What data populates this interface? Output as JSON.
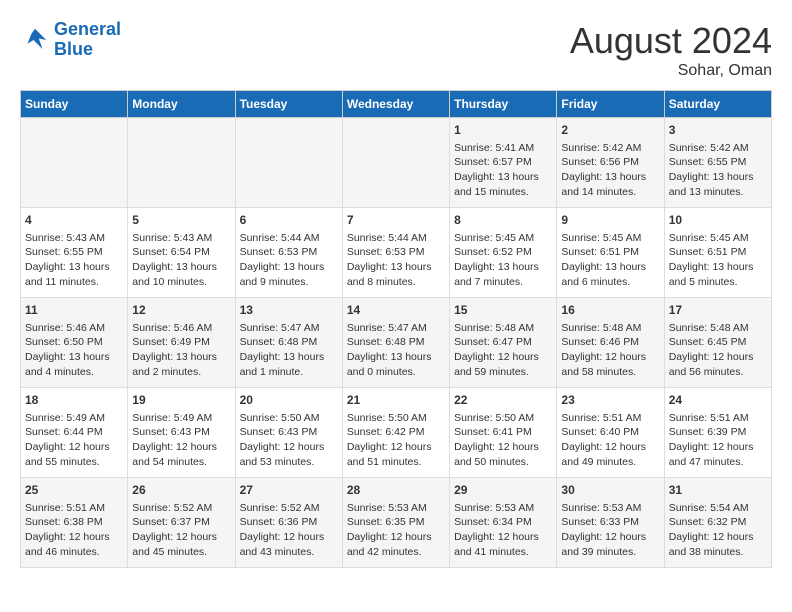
{
  "header": {
    "logo_line1": "General",
    "logo_line2": "Blue",
    "main_title": "August 2024",
    "subtitle": "Sohar, Oman"
  },
  "days_of_week": [
    "Sunday",
    "Monday",
    "Tuesday",
    "Wednesday",
    "Thursday",
    "Friday",
    "Saturday"
  ],
  "weeks": [
    [
      {
        "day": "",
        "content": ""
      },
      {
        "day": "",
        "content": ""
      },
      {
        "day": "",
        "content": ""
      },
      {
        "day": "",
        "content": ""
      },
      {
        "day": "1",
        "content": "Sunrise: 5:41 AM\nSunset: 6:57 PM\nDaylight: 13 hours\nand 15 minutes."
      },
      {
        "day": "2",
        "content": "Sunrise: 5:42 AM\nSunset: 6:56 PM\nDaylight: 13 hours\nand 14 minutes."
      },
      {
        "day": "3",
        "content": "Sunrise: 5:42 AM\nSunset: 6:55 PM\nDaylight: 13 hours\nand 13 minutes."
      }
    ],
    [
      {
        "day": "4",
        "content": "Sunrise: 5:43 AM\nSunset: 6:55 PM\nDaylight: 13 hours\nand 11 minutes."
      },
      {
        "day": "5",
        "content": "Sunrise: 5:43 AM\nSunset: 6:54 PM\nDaylight: 13 hours\nand 10 minutes."
      },
      {
        "day": "6",
        "content": "Sunrise: 5:44 AM\nSunset: 6:53 PM\nDaylight: 13 hours\nand 9 minutes."
      },
      {
        "day": "7",
        "content": "Sunrise: 5:44 AM\nSunset: 6:53 PM\nDaylight: 13 hours\nand 8 minutes."
      },
      {
        "day": "8",
        "content": "Sunrise: 5:45 AM\nSunset: 6:52 PM\nDaylight: 13 hours\nand 7 minutes."
      },
      {
        "day": "9",
        "content": "Sunrise: 5:45 AM\nSunset: 6:51 PM\nDaylight: 13 hours\nand 6 minutes."
      },
      {
        "day": "10",
        "content": "Sunrise: 5:45 AM\nSunset: 6:51 PM\nDaylight: 13 hours\nand 5 minutes."
      }
    ],
    [
      {
        "day": "11",
        "content": "Sunrise: 5:46 AM\nSunset: 6:50 PM\nDaylight: 13 hours\nand 4 minutes."
      },
      {
        "day": "12",
        "content": "Sunrise: 5:46 AM\nSunset: 6:49 PM\nDaylight: 13 hours\nand 2 minutes."
      },
      {
        "day": "13",
        "content": "Sunrise: 5:47 AM\nSunset: 6:48 PM\nDaylight: 13 hours\nand 1 minute."
      },
      {
        "day": "14",
        "content": "Sunrise: 5:47 AM\nSunset: 6:48 PM\nDaylight: 13 hours\nand 0 minutes."
      },
      {
        "day": "15",
        "content": "Sunrise: 5:48 AM\nSunset: 6:47 PM\nDaylight: 12 hours\nand 59 minutes."
      },
      {
        "day": "16",
        "content": "Sunrise: 5:48 AM\nSunset: 6:46 PM\nDaylight: 12 hours\nand 58 minutes."
      },
      {
        "day": "17",
        "content": "Sunrise: 5:48 AM\nSunset: 6:45 PM\nDaylight: 12 hours\nand 56 minutes."
      }
    ],
    [
      {
        "day": "18",
        "content": "Sunrise: 5:49 AM\nSunset: 6:44 PM\nDaylight: 12 hours\nand 55 minutes."
      },
      {
        "day": "19",
        "content": "Sunrise: 5:49 AM\nSunset: 6:43 PM\nDaylight: 12 hours\nand 54 minutes."
      },
      {
        "day": "20",
        "content": "Sunrise: 5:50 AM\nSunset: 6:43 PM\nDaylight: 12 hours\nand 53 minutes."
      },
      {
        "day": "21",
        "content": "Sunrise: 5:50 AM\nSunset: 6:42 PM\nDaylight: 12 hours\nand 51 minutes."
      },
      {
        "day": "22",
        "content": "Sunrise: 5:50 AM\nSunset: 6:41 PM\nDaylight: 12 hours\nand 50 minutes."
      },
      {
        "day": "23",
        "content": "Sunrise: 5:51 AM\nSunset: 6:40 PM\nDaylight: 12 hours\nand 49 minutes."
      },
      {
        "day": "24",
        "content": "Sunrise: 5:51 AM\nSunset: 6:39 PM\nDaylight: 12 hours\nand 47 minutes."
      }
    ],
    [
      {
        "day": "25",
        "content": "Sunrise: 5:51 AM\nSunset: 6:38 PM\nDaylight: 12 hours\nand 46 minutes."
      },
      {
        "day": "26",
        "content": "Sunrise: 5:52 AM\nSunset: 6:37 PM\nDaylight: 12 hours\nand 45 minutes."
      },
      {
        "day": "27",
        "content": "Sunrise: 5:52 AM\nSunset: 6:36 PM\nDaylight: 12 hours\nand 43 minutes."
      },
      {
        "day": "28",
        "content": "Sunrise: 5:53 AM\nSunset: 6:35 PM\nDaylight: 12 hours\nand 42 minutes."
      },
      {
        "day": "29",
        "content": "Sunrise: 5:53 AM\nSunset: 6:34 PM\nDaylight: 12 hours\nand 41 minutes."
      },
      {
        "day": "30",
        "content": "Sunrise: 5:53 AM\nSunset: 6:33 PM\nDaylight: 12 hours\nand 39 minutes."
      },
      {
        "day": "31",
        "content": "Sunrise: 5:54 AM\nSunset: 6:32 PM\nDaylight: 12 hours\nand 38 minutes."
      }
    ]
  ]
}
